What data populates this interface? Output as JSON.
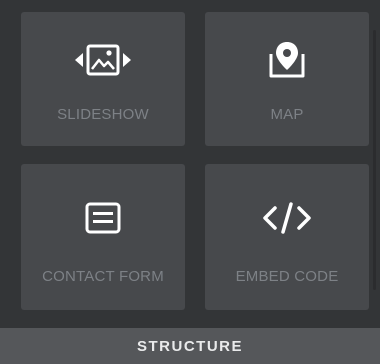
{
  "panel": {
    "section_title": "STRUCTURE",
    "tiles": [
      {
        "label": "SLIDESHOW",
        "icon": "slideshow-icon"
      },
      {
        "label": "MAP",
        "icon": "map-pin-icon"
      },
      {
        "label": "CONTACT FORM",
        "icon": "contact-form-icon"
      },
      {
        "label": "EMBED CODE",
        "icon": "embed-code-icon"
      }
    ]
  },
  "colors": {
    "background": "#333537",
    "tile": "#47494c",
    "icon": "#ffffff",
    "label": "#7d8186",
    "footer": "#55575a",
    "footer_text": "#e9eaeb"
  }
}
